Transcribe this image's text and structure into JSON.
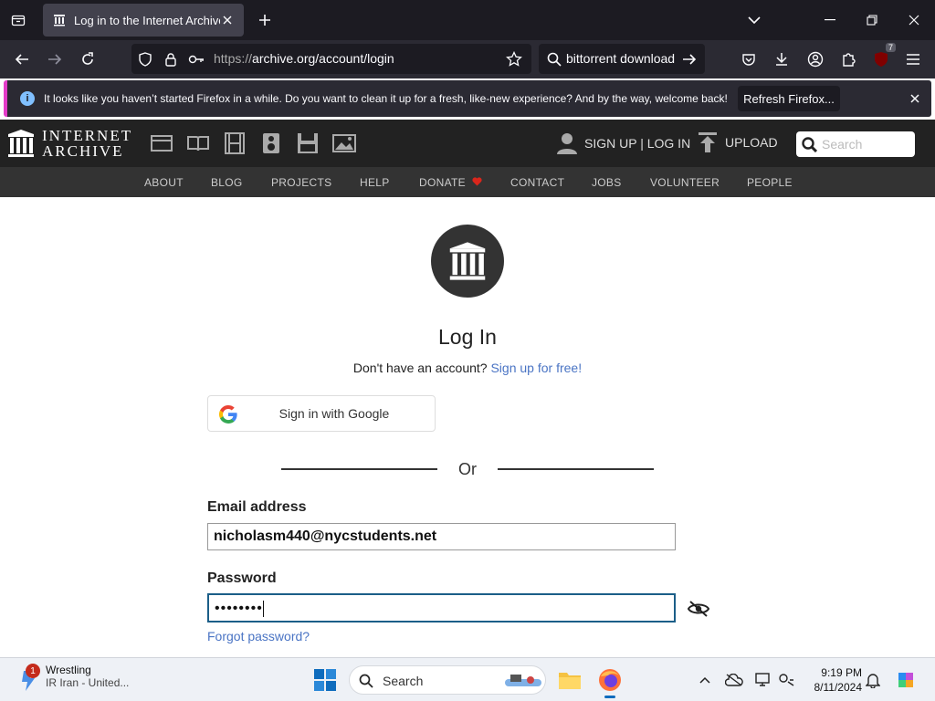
{
  "browser": {
    "tab_title": "Log in to the Internet Archive",
    "url_scheme": "https://",
    "url_rest": "archive.org/account/login",
    "search_query": "bittorrent download",
    "extension_badge": "7",
    "notification": "It looks like you haven’t started Firefox in a while. Do you want to clean it up for a fresh, like-new experience? And by the way, welcome back!",
    "refresh_label": "Refresh Firefox..."
  },
  "ia": {
    "logo_line1": "INTERNET",
    "logo_line2": "ARCHIVE",
    "signup_login": "SIGN UP | LOG IN",
    "upload": "UPLOAD",
    "search_placeholder": "Search",
    "menu": [
      "ABOUT",
      "BLOG",
      "PROJECTS",
      "HELP",
      "DONATE",
      "CONTACT",
      "JOBS",
      "VOLUNTEER",
      "PEOPLE"
    ],
    "donate_heart_color": "#d9261c"
  },
  "login": {
    "title": "Log In",
    "no_account": "Don't have an account?",
    "signup_link": "Sign up for free!",
    "google_label": "Sign in with Google",
    "or": "Or",
    "email_label": "Email address",
    "email_value": "nicholasm440@nycstudents.net",
    "password_label": "Password",
    "password_value": "••••••••",
    "forgot": "Forgot password?"
  },
  "taskbar": {
    "weather_title": "Wrestling",
    "weather_sub": "IR Iran - United...",
    "weather_badge": "1",
    "search_label": "Search",
    "time": "9:19 PM",
    "date": "8/11/2024"
  }
}
